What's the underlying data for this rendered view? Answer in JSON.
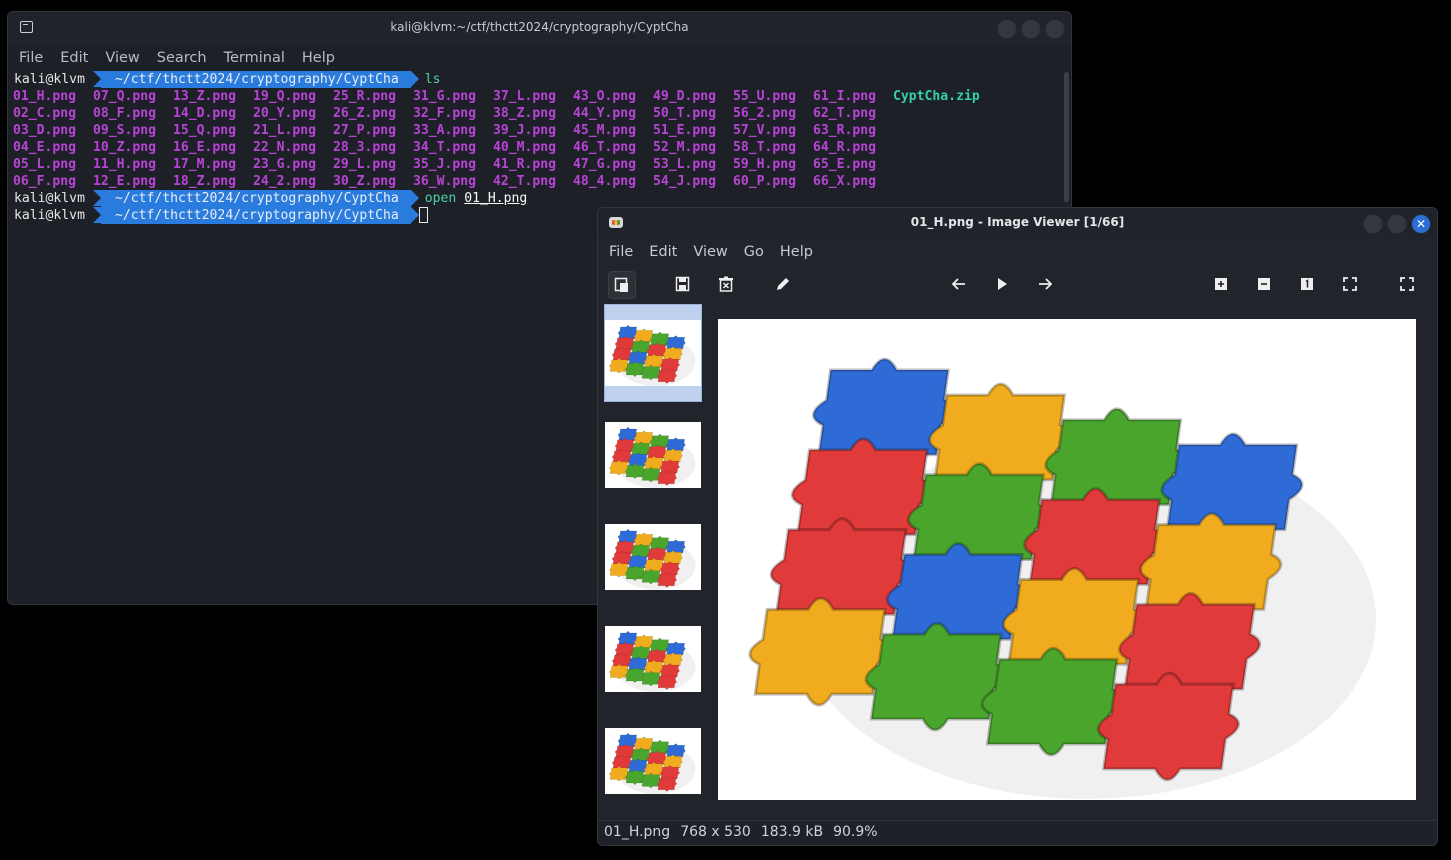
{
  "terminal": {
    "title": "kali@klvm:~/ctf/thctt2024/cryptography/CyptCha",
    "menu": [
      "File",
      "Edit",
      "View",
      "Search",
      "Terminal",
      "Help"
    ],
    "prompt_user": "kali@klvm",
    "prompt_path": "~/ctf/thctt2024/cryptography/CyptCha",
    "cmd1": "ls",
    "cmd2": "open",
    "cmd2_arg": "01_H.png",
    "file_rows": [
      [
        "01_H.png",
        "07_Q.png",
        "13_Z.png",
        "19_Q.png",
        "25_R.png",
        "31_G.png",
        "37_L.png",
        "43_O.png",
        "49_D.png",
        "55_U.png",
        "61_I.png"
      ],
      [
        "02_C.png",
        "08_F.png",
        "14_D.png",
        "20_Y.png",
        "26_Z.png",
        "32_F.png",
        "38_Z.png",
        "44_Y.png",
        "50_T.png",
        "56_2.png",
        "62_T.png"
      ],
      [
        "03_D.png",
        "09_S.png",
        "15_Q.png",
        "21_L.png",
        "27_P.png",
        "33_A.png",
        "39_J.png",
        "45_M.png",
        "51_E.png",
        "57_V.png",
        "63_R.png"
      ],
      [
        "04_E.png",
        "10_Z.png",
        "16_E.png",
        "22_N.png",
        "28_3.png",
        "34_T.png",
        "40_M.png",
        "46_T.png",
        "52_M.png",
        "58_T.png",
        "64_R.png"
      ],
      [
        "05_L.png",
        "11_H.png",
        "17_M.png",
        "23_G.png",
        "29_L.png",
        "35_J.png",
        "41_R.png",
        "47_G.png",
        "53_L.png",
        "59_H.png",
        "65_E.png"
      ],
      [
        "06_F.png",
        "12_E.png",
        "18_Z.png",
        "24_2.png",
        "30_Z.png",
        "36_W.png",
        "42_T.png",
        "48_4.png",
        "54_J.png",
        "60_P.png",
        "66_X.png"
      ]
    ],
    "zip_file": "CyptCha.zip"
  },
  "viewer": {
    "title": "01_H.png - Image Viewer [1/66]",
    "close_glyph": "✕",
    "menu": [
      "File",
      "Edit",
      "View",
      "Go",
      "Help"
    ],
    "status": {
      "filename": "01_H.png",
      "dimensions": "768 x 530",
      "size": "183.9 kB",
      "zoom": "90.9%"
    },
    "tool_icons": [
      "sidebar-icon",
      "save-icon",
      "delete-icon",
      "edit-icon",
      "back-arrow-icon",
      "play-icon",
      "forward-arrow-icon",
      "zoom-in-icon",
      "zoom-out-icon",
      "actual-size-icon",
      "fit-icon",
      "fullscreen-icon"
    ],
    "colors": {
      "accent": "#2a7bde",
      "puzzle": [
        "#e03a3a",
        "#f0ac1e",
        "#4aa52c",
        "#2f6bd6"
      ]
    }
  }
}
